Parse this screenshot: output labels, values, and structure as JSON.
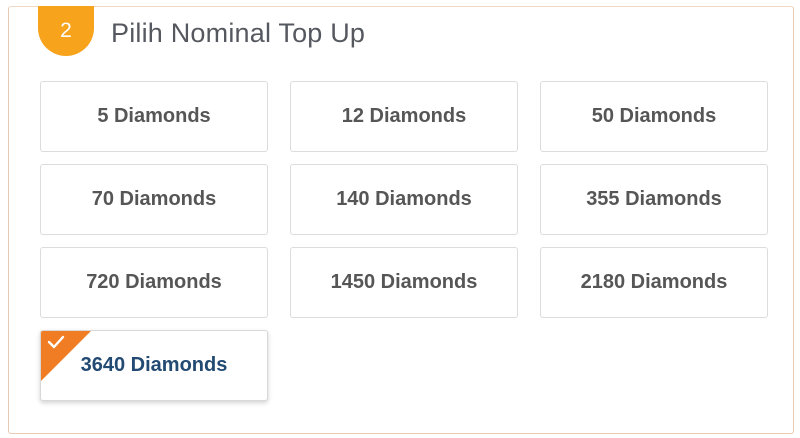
{
  "step": {
    "number": "2",
    "title": "Pilih Nominal Top Up"
  },
  "options": [
    {
      "label": "5 Diamonds",
      "selected": false
    },
    {
      "label": "12 Diamonds",
      "selected": false
    },
    {
      "label": "50 Diamonds",
      "selected": false
    },
    {
      "label": "70 Diamonds",
      "selected": false
    },
    {
      "label": "140 Diamonds",
      "selected": false
    },
    {
      "label": "355 Diamonds",
      "selected": false
    },
    {
      "label": "720 Diamonds",
      "selected": false
    },
    {
      "label": "1450 Diamonds",
      "selected": false
    },
    {
      "label": "2180 Diamonds",
      "selected": false
    },
    {
      "label": "3640 Diamonds",
      "selected": true
    }
  ],
  "colors": {
    "badge": "#f7a31c",
    "selected_corner": "#f07d23",
    "selected_text": "#234a72",
    "option_text": "#565656"
  },
  "icons": {
    "selected_indicator": "check-icon"
  }
}
